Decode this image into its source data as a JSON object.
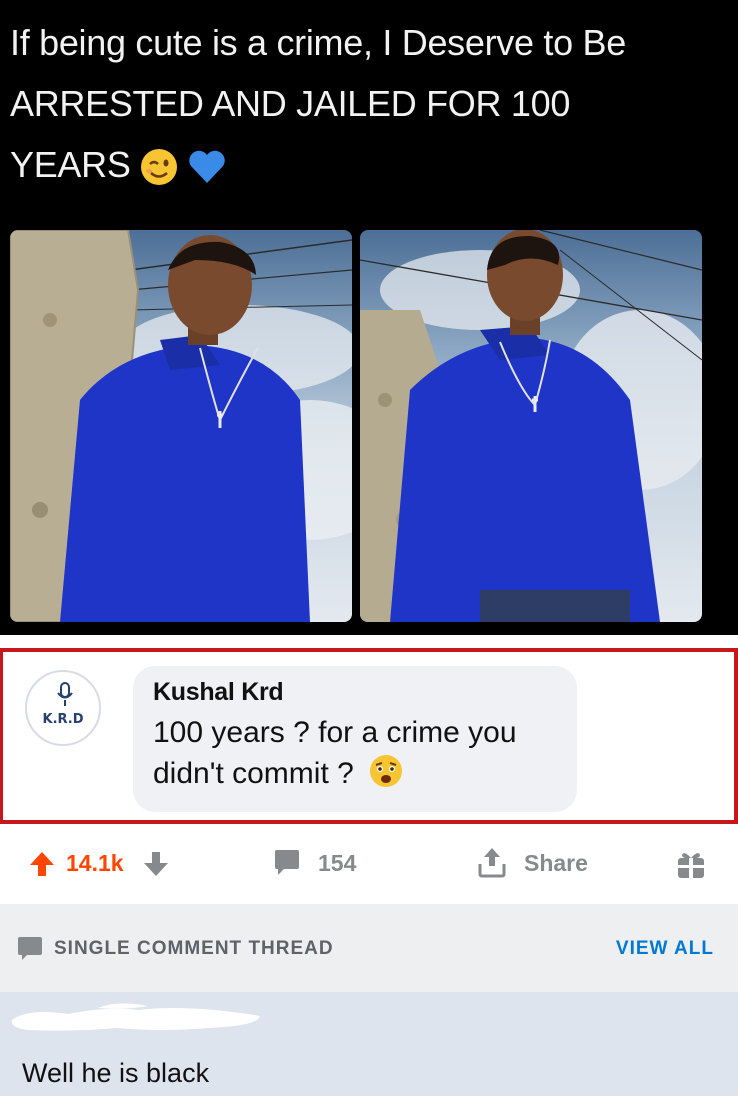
{
  "post": {
    "caption_lines": [
      "If being cute is a crime, I Deserve to Be",
      "ARRESTED AND JAILED FOR 100",
      "YEARS"
    ],
    "caption_emojis": [
      "winking-face",
      "blue-heart"
    ]
  },
  "comment": {
    "author": "Kushal Krd",
    "avatar_text": "K.R.D",
    "text": "100 years ? for a crime you didn't commit ?",
    "text_emoji": "anguished-face"
  },
  "actions": {
    "vote_count": "14.1k",
    "comment_count": "154",
    "share_label": "Share"
  },
  "thread": {
    "label": "SINGLE COMMENT THREAD",
    "view_all": "VIEW ALL"
  },
  "reply": {
    "text": "Well he is black"
  },
  "colors": {
    "highlight_border": "#c8161d",
    "upvote": "#ff4500",
    "link": "#0079d3",
    "sweater_blue": "#1f35c8"
  }
}
